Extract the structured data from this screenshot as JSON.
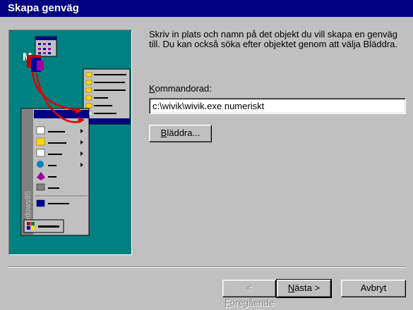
{
  "window": {
    "title": "Skapa genväg"
  },
  "instructions": "Skriv in plats och namn på det objekt du vill skapa en genväg till. Du kan också söka efter objektet genom att välja Bläddra.",
  "command": {
    "label_accel": "K",
    "label_rest": "ommandorad:",
    "value": "c:\\wivik\\wivik.exe numeriskt"
  },
  "buttons": {
    "browse_accel": "B",
    "browse_rest": "läddra...",
    "back_lead": "< ",
    "back_accel": "F",
    "back_rest": "öregående",
    "next_accel": "N",
    "next_rest": "ästa >",
    "cancel": "Avbryt"
  },
  "illustration": {
    "sidebar_text": "Windows95"
  },
  "colors": {
    "titlebar": "#000080",
    "illustration_bg": "#008080",
    "face": "#c0c0c0"
  }
}
